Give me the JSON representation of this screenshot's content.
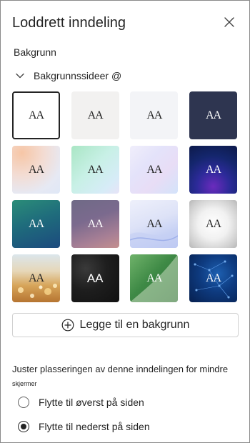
{
  "header": {
    "title": "Loddrett inndeling",
    "close_icon": "close-icon"
  },
  "background": {
    "section_label": "Bakgrunn",
    "group_label": "Bakgrunnssideer @",
    "tile_label": "AA",
    "tiles": [
      {
        "name": "white",
        "selected": true
      },
      {
        "name": "light-gray"
      },
      {
        "name": "pale-gray"
      },
      {
        "name": "dark-navy"
      },
      {
        "name": "peach-gradient"
      },
      {
        "name": "mint-gradient"
      },
      {
        "name": "lavender-gradient"
      },
      {
        "name": "blue-purple-gradient"
      },
      {
        "name": "teal-gradient"
      },
      {
        "name": "mauve-gradient"
      },
      {
        "name": "blue-wave"
      },
      {
        "name": "white-leaves"
      },
      {
        "name": "gold-bokeh"
      },
      {
        "name": "black-texture"
      },
      {
        "name": "green-curve"
      },
      {
        "name": "blue-network"
      }
    ],
    "add_button_label": "Legge til en bakgrunn"
  },
  "adjust": {
    "text": "Juster plasseringen av denne inndelingen for mindre",
    "subtext": "skjermer",
    "options": [
      {
        "label": "Flytte til øverst på siden",
        "checked": false
      },
      {
        "label": "Flytte til nederst på siden",
        "checked": true
      }
    ]
  }
}
